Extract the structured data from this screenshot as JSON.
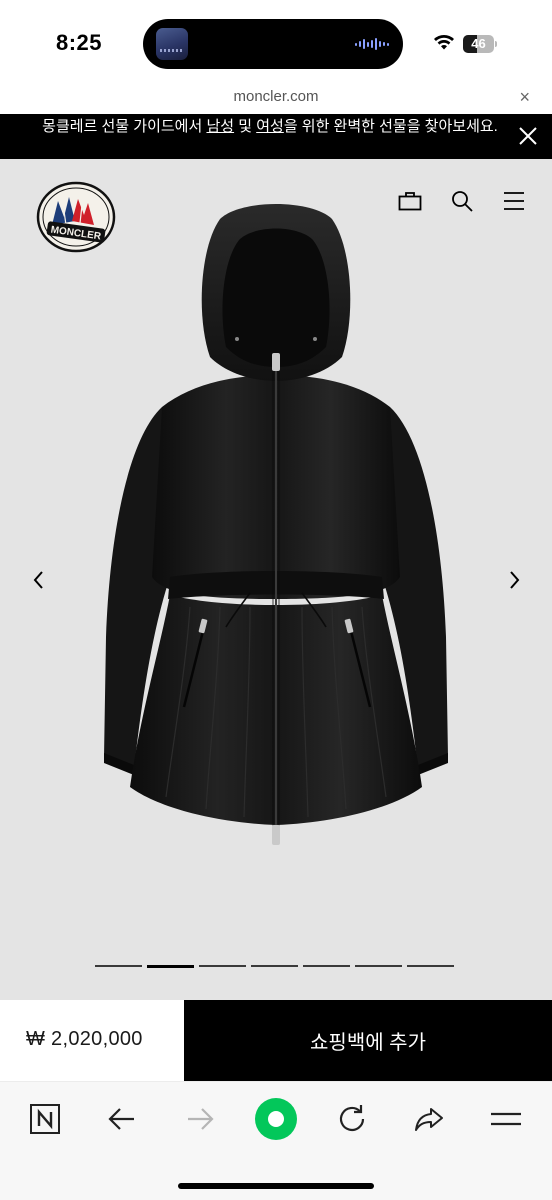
{
  "status_bar": {
    "time": "8:25",
    "battery_level": "46",
    "battery_fraction": 0.46
  },
  "browser": {
    "url": "moncler.com",
    "close_glyph": "×"
  },
  "announcement": {
    "text_before": "몽클레르 선물 가이드에서 ",
    "link_men": "남성",
    "text_middle": " 및 ",
    "link_women": "여성",
    "text_after": "을 위한 완벽한 선물을 찾아보세요."
  },
  "header": {
    "logo_text": "MONCLER",
    "icons": [
      "shopping-bag-icon",
      "search-icon",
      "menu-icon"
    ]
  },
  "gallery": {
    "image_subject": "black hooded jacket with drawstring waist",
    "slide_count": 7,
    "active_slide": 2,
    "prev_icon": "chevron-left-icon",
    "next_icon": "chevron-right-icon"
  },
  "purchase": {
    "price": "₩ 2,020,000",
    "add_to_bag_label": "쇼핑백에 추가"
  },
  "toolbar": {
    "icons": [
      "naver-n-icon",
      "back-arrow-icon",
      "forward-arrow-icon",
      "green-home-icon",
      "reload-icon",
      "share-icon",
      "menu-icon"
    ]
  },
  "colors": {
    "stage_background": "#e4e4e4",
    "accent_green": "#03c75a",
    "logo_red": "#d0202a",
    "logo_blue": "#1d3d7a"
  }
}
